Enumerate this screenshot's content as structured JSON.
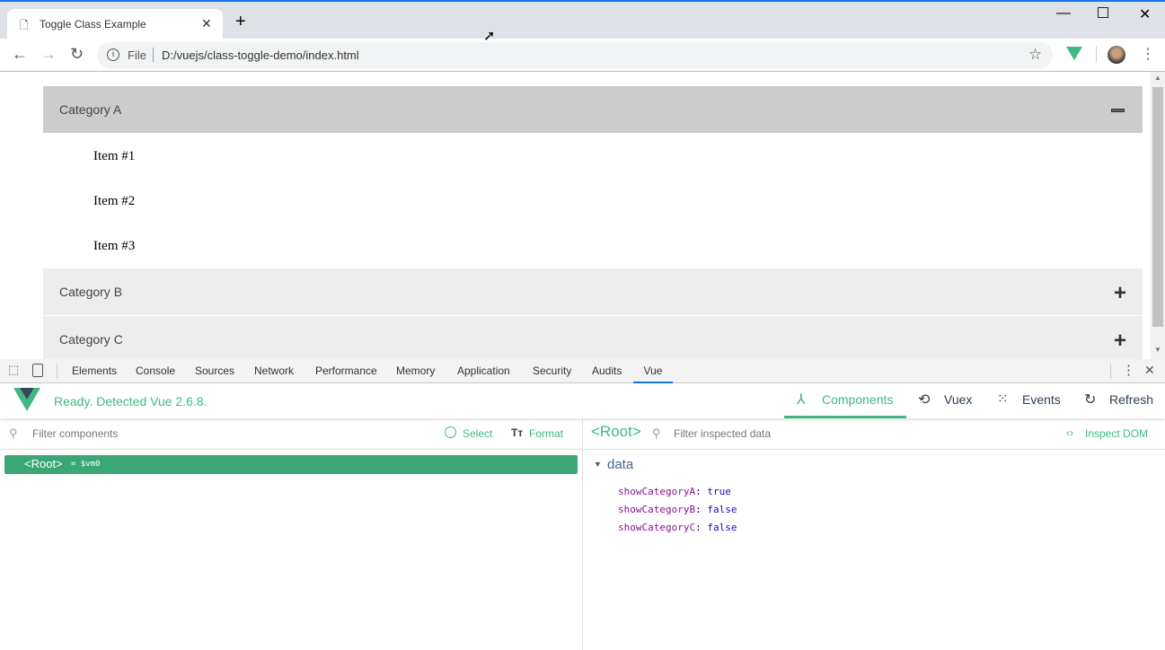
{
  "browser": {
    "tab_title": "Toggle Class Example",
    "url_scheme": "File",
    "url": "D:/vuejs/class-toggle-demo/index.html"
  },
  "page": {
    "categories": [
      {
        "label": "Category A",
        "expanded": true,
        "toggle": "−",
        "items": [
          "Item #1",
          "Item #2",
          "Item #3"
        ]
      },
      {
        "label": "Category B",
        "expanded": false,
        "toggle": "+"
      },
      {
        "label": "Category C",
        "expanded": false,
        "toggle": "+"
      }
    ]
  },
  "devtools": {
    "tabs": [
      "Elements",
      "Console",
      "Sources",
      "Network",
      "Performance",
      "Memory",
      "Application",
      "Security",
      "Audits",
      "Vue"
    ],
    "active_tab": "Vue"
  },
  "vue": {
    "status": "Ready. Detected Vue 2.6.8.",
    "nav": [
      "Components",
      "Vuex",
      "Events",
      "Refresh"
    ],
    "filter_components_placeholder": "Filter components",
    "select": "Select",
    "format": "Format",
    "root_tag": "<Root>",
    "root_vm": "= $vm0",
    "inspected": "<Root>",
    "filter_data_placeholder": "Filter inspected data",
    "inspect_dom": "Inspect DOM",
    "section": "data",
    "props": [
      {
        "key": "showCategoryA",
        "value": "true"
      },
      {
        "key": "showCategoryB",
        "value": "false"
      },
      {
        "key": "showCategoryC",
        "value": "false"
      }
    ],
    "colors": {
      "green": "#41b883",
      "selected_row": "#3ba776",
      "key": "#881391",
      "value": "#1c00cf"
    }
  }
}
